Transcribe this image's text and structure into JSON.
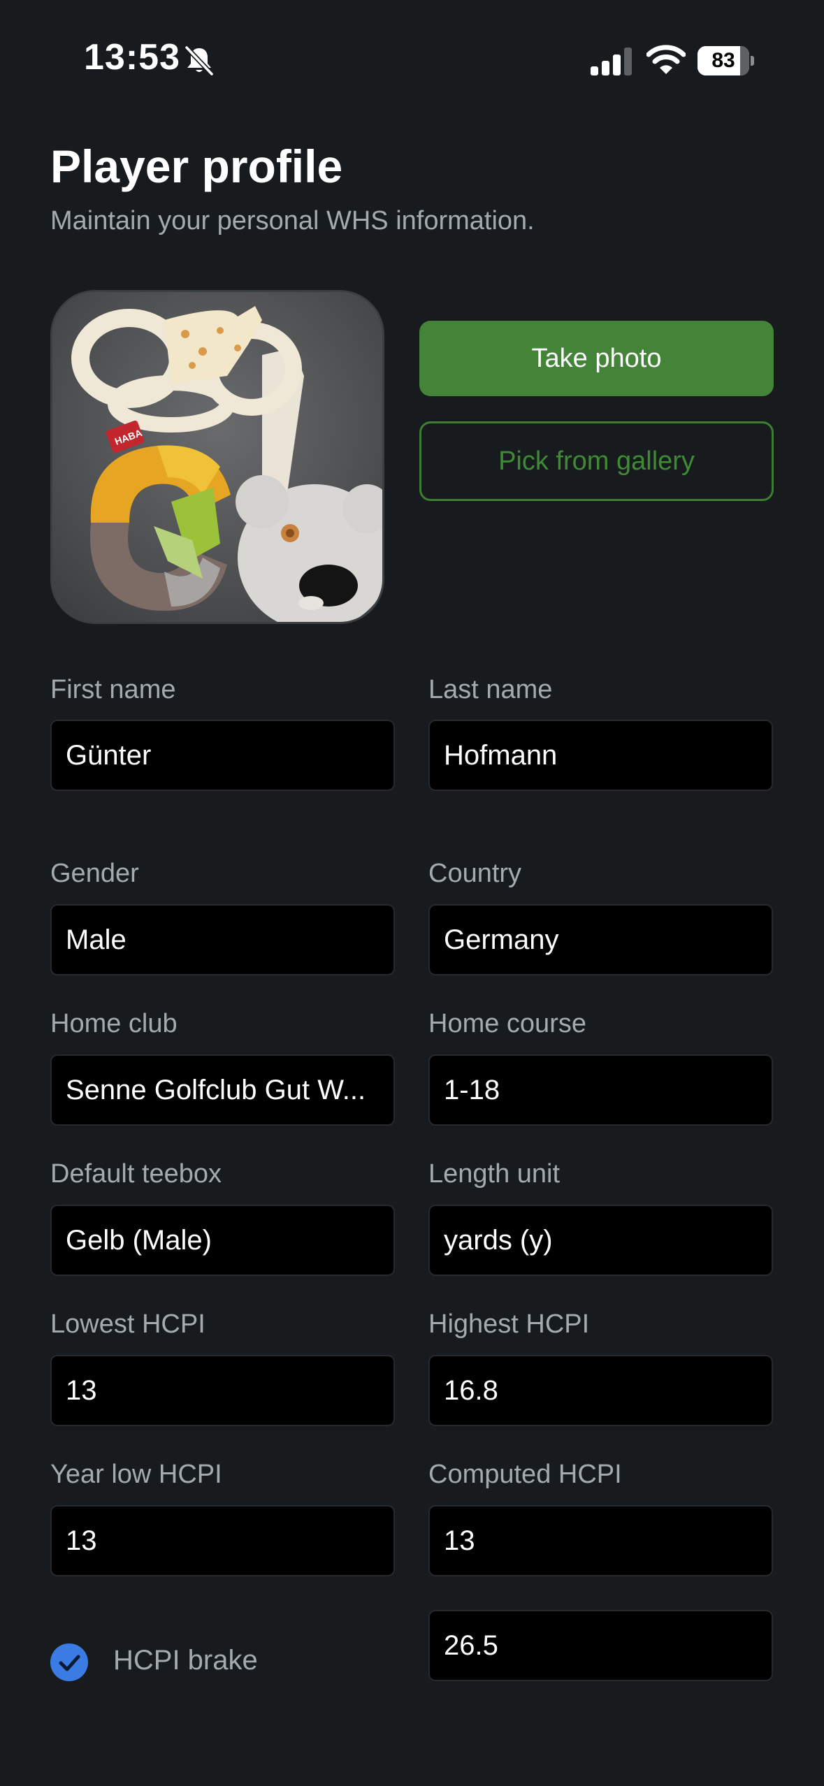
{
  "status_bar": {
    "time": "13:53",
    "battery_percent": "83",
    "battery_level": 0.83
  },
  "header": {
    "title": "Player profile",
    "subtitle": "Maintain your personal WHS information."
  },
  "photo": {
    "take_label": "Take photo",
    "pick_label": "Pick from gallery",
    "logo_text": "HABA"
  },
  "form": {
    "first_name": {
      "label": "First name",
      "value": "Günter"
    },
    "last_name": {
      "label": "Last name",
      "value": "Hofmann"
    },
    "gender": {
      "label": "Gender",
      "value": "Male"
    },
    "country": {
      "label": "Country",
      "value": "Germany"
    },
    "home_club": {
      "label": "Home club",
      "value": "Senne Golfclub Gut W..."
    },
    "home_course": {
      "label": "Home course",
      "value": "1-18"
    },
    "default_teebox": {
      "label": "Default teebox",
      "value": "Gelb (Male)"
    },
    "length_unit": {
      "label": "Length unit",
      "value": "yards (y)"
    },
    "lowest_hcpi": {
      "label": "Lowest HCPI",
      "value": "13"
    },
    "highest_hcpi": {
      "label": "Highest HCPI",
      "value": "16.8"
    },
    "year_low_hcpi": {
      "label": "Year low HCPI",
      "value": "13"
    },
    "computed_hcpi": {
      "label": "Computed HCPI",
      "value": "13"
    },
    "hcpi_brake": {
      "label": "HCPI brake",
      "checked": true,
      "value": "26.5"
    }
  },
  "colors": {
    "background": "#171b1d",
    "accent_green": "#448439",
    "checkbox_blue": "#3b7ce4",
    "label_gray": "#a4abb0"
  },
  "icons": {
    "bell": "bell-slash-icon",
    "signal": "cellular-signal-icon",
    "wifi": "wifi-icon",
    "check": "checkmark-icon"
  }
}
